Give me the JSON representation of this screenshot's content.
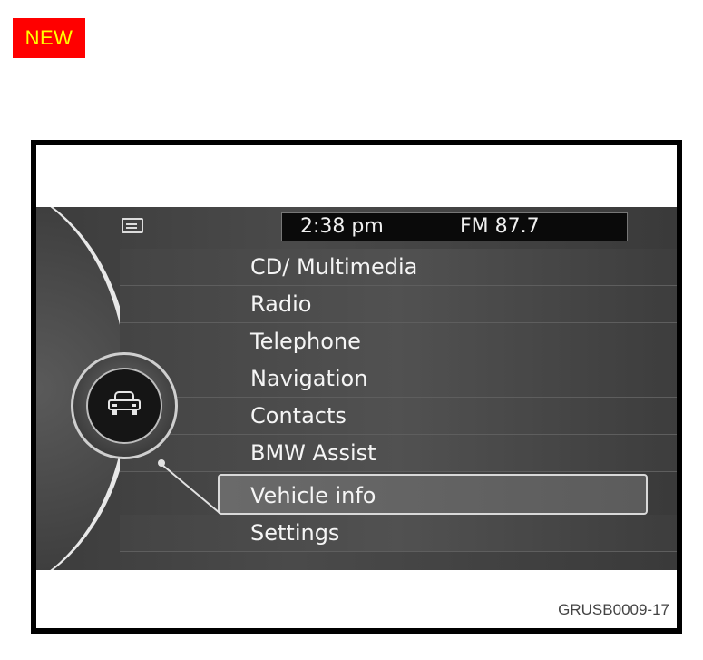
{
  "badge": {
    "label": "NEW"
  },
  "status": {
    "time": "2:38 pm",
    "radio": "FM 87.7"
  },
  "icons": {
    "status_icon": "display-icon",
    "controller_icon": "car-icon"
  },
  "menu": {
    "items": [
      {
        "label": "CD/ Multimedia"
      },
      {
        "label": "Radio"
      },
      {
        "label": "Telephone"
      },
      {
        "label": "Navigation"
      },
      {
        "label": "Contacts"
      },
      {
        "label": "BMW Assist"
      },
      {
        "label": "Vehicle info",
        "selected": true
      },
      {
        "label": "Settings"
      }
    ]
  },
  "caption": {
    "code": "GRUSB0009-17"
  },
  "colors": {
    "badge_bg": "#ff0000",
    "badge_text": "#ffff00"
  }
}
